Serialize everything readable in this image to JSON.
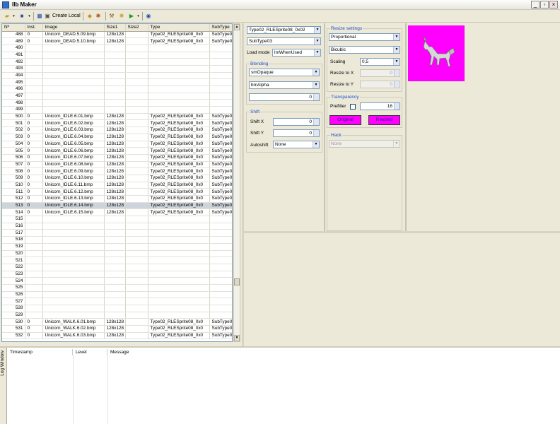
{
  "window": {
    "title": "llb Maker"
  },
  "toolbar": {
    "create_local": "Create Local"
  },
  "grid": {
    "columns": [
      "Nº",
      "Inst.",
      "Image",
      "Size1",
      "Size2",
      "Type",
      "SubType"
    ],
    "rows": [
      [
        "488",
        "0",
        "Unicorn_DEAD.5.09.bmp",
        "128x128",
        "",
        "Type02_RLESprite08_0x0",
        "SubType0"
      ],
      [
        "489",
        "0",
        "Unicorn_DEAD.5.10.bmp",
        "128x128",
        "",
        "Type02_RLESprite08_0x0",
        "SubType0"
      ],
      [
        "490",
        "",
        "",
        "",
        "",
        "",
        ""
      ],
      [
        "491",
        "",
        "",
        "",
        "",
        "",
        ""
      ],
      [
        "492",
        "",
        "",
        "",
        "",
        "",
        ""
      ],
      [
        "493",
        "",
        "",
        "",
        "",
        "",
        ""
      ],
      [
        "494",
        "",
        "",
        "",
        "",
        "",
        ""
      ],
      [
        "495",
        "",
        "",
        "",
        "",
        "",
        ""
      ],
      [
        "496",
        "",
        "",
        "",
        "",
        "",
        ""
      ],
      [
        "497",
        "",
        "",
        "",
        "",
        "",
        ""
      ],
      [
        "498",
        "",
        "",
        "",
        "",
        "",
        ""
      ],
      [
        "499",
        "",
        "",
        "",
        "",
        "",
        ""
      ],
      [
        "500",
        "0",
        "Unicorn_IDLE.6.01.bmp",
        "128x128",
        "",
        "Type02_RLESprite08_0x0",
        "SubType0"
      ],
      [
        "501",
        "0",
        "Unicorn_IDLE.6.02.bmp",
        "128x128",
        "",
        "Type02_RLESprite08_0x0",
        "SubType0"
      ],
      [
        "502",
        "0",
        "Unicorn_IDLE.6.03.bmp",
        "128x128",
        "",
        "Type02_RLESprite08_0x0",
        "SubType0"
      ],
      [
        "503",
        "0",
        "Unicorn_IDLE.6.04.bmp",
        "128x128",
        "",
        "Type02_RLESprite08_0x0",
        "SubType0"
      ],
      [
        "504",
        "0",
        "Unicorn_IDLE.6.05.bmp",
        "128x128",
        "",
        "Type02_RLESprite08_0x0",
        "SubType0"
      ],
      [
        "505",
        "0",
        "Unicorn_IDLE.6.06.bmp",
        "128x128",
        "",
        "Type02_RLESprite08_0x0",
        "SubType0"
      ],
      [
        "506",
        "0",
        "Unicorn_IDLE.6.07.bmp",
        "128x128",
        "",
        "Type02_RLESprite08_0x0",
        "SubType0"
      ],
      [
        "507",
        "0",
        "Unicorn_IDLE.6.08.bmp",
        "128x128",
        "",
        "Type02_RLESprite08_0x0",
        "SubType0"
      ],
      [
        "508",
        "0",
        "Unicorn_IDLE.6.09.bmp",
        "128x128",
        "",
        "Type02_RLESprite08_0x0",
        "SubType0"
      ],
      [
        "509",
        "0",
        "Unicorn_IDLE.6.10.bmp",
        "128x128",
        "",
        "Type02_RLESprite08_0x0",
        "SubType0"
      ],
      [
        "510",
        "0",
        "Unicorn_IDLE.6.11.bmp",
        "128x128",
        "",
        "Type02_RLESprite08_0x0",
        "SubType0"
      ],
      [
        "511",
        "0",
        "Unicorn_IDLE.6.12.bmp",
        "128x128",
        "",
        "Type02_RLESprite08_0x0",
        "SubType0"
      ],
      [
        "512",
        "0",
        "Unicorn_IDLE.6.13.bmp",
        "128x128",
        "",
        "Type02_RLESprite08_0x0",
        "SubType0"
      ],
      [
        "513",
        "0",
        "Unicorn_IDLE.6.14.bmp",
        "128x128",
        "",
        "Type02_RLESprite08_0x0",
        "SubType0"
      ],
      [
        "514",
        "0",
        "Unicorn_IDLE.6.15.bmp",
        "128x128",
        "",
        "Type02_RLESprite08_0x0",
        "SubType0"
      ],
      [
        "515",
        "",
        "",
        "",
        "",
        "",
        ""
      ],
      [
        "516",
        "",
        "",
        "",
        "",
        "",
        ""
      ],
      [
        "517",
        "",
        "",
        "",
        "",
        "",
        ""
      ],
      [
        "518",
        "",
        "",
        "",
        "",
        "",
        ""
      ],
      [
        "519",
        "",
        "",
        "",
        "",
        "",
        ""
      ],
      [
        "520",
        "",
        "",
        "",
        "",
        "",
        ""
      ],
      [
        "521",
        "",
        "",
        "",
        "",
        "",
        ""
      ],
      [
        "522",
        "",
        "",
        "",
        "",
        "",
        ""
      ],
      [
        "523",
        "",
        "",
        "",
        "",
        "",
        ""
      ],
      [
        "524",
        "",
        "",
        "",
        "",
        "",
        ""
      ],
      [
        "525",
        "",
        "",
        "",
        "",
        "",
        ""
      ],
      [
        "526",
        "",
        "",
        "",
        "",
        "",
        ""
      ],
      [
        "527",
        "",
        "",
        "",
        "",
        "",
        ""
      ],
      [
        "528",
        "",
        "",
        "",
        "",
        "",
        ""
      ],
      [
        "529",
        "",
        "",
        "",
        "",
        "",
        ""
      ],
      [
        "530",
        "0",
        "Unicorn_WALK.6.01.bmp",
        "128x128",
        "",
        "Type02_RLESprite08_0x0",
        "SubType0"
      ],
      [
        "531",
        "0",
        "Unicorn_WALK.6.02.bmp",
        "128x128",
        "",
        "Type02_RLESprite08_0x0",
        "SubType0"
      ],
      [
        "532",
        "0",
        "Unicorn_WALK.6.03.bmp",
        "128x128",
        "",
        "Type02_RLESprite08_0x0",
        "SubType0"
      ]
    ],
    "selected_index": 25
  },
  "props": {
    "type_value": "Type02_RLESprite08_0x02",
    "subtype_value": "SubType03",
    "load_mode_label": "Load mode",
    "load_mode_value": "lmWhenUsed",
    "blending_title": "Blending",
    "blend1": "smOpaque",
    "blend2": "bmAlpha",
    "blend_num": "0",
    "shift_title": "Shift",
    "shift_x_label": "Shift X",
    "shift_x": "0",
    "shift_y_label": "Shift Y",
    "shift_y": "0",
    "autoshift_label": "Autoshift",
    "autoshift": "None"
  },
  "resize": {
    "title": "Resize settings",
    "mode": "Proportional",
    "filter": "Bicubic",
    "scaling_label": "Scaling",
    "scaling": "0,5",
    "resize_x_label": "Resize to X",
    "resize_x": "0",
    "resize_y_label": "Resize to Y",
    "resize_y": "0"
  },
  "transparency": {
    "title": "Transparency",
    "prefilter_label": "Prefilter",
    "prefilter_value": "16",
    "original_button": "Original",
    "resized_button": "Resized",
    "color": "#ff00ff"
  },
  "hack": {
    "title": "Hack",
    "value": "None"
  },
  "log": {
    "tab_label": "Log Window",
    "columns": [
      "Timestamp",
      "Level",
      "Message"
    ]
  }
}
